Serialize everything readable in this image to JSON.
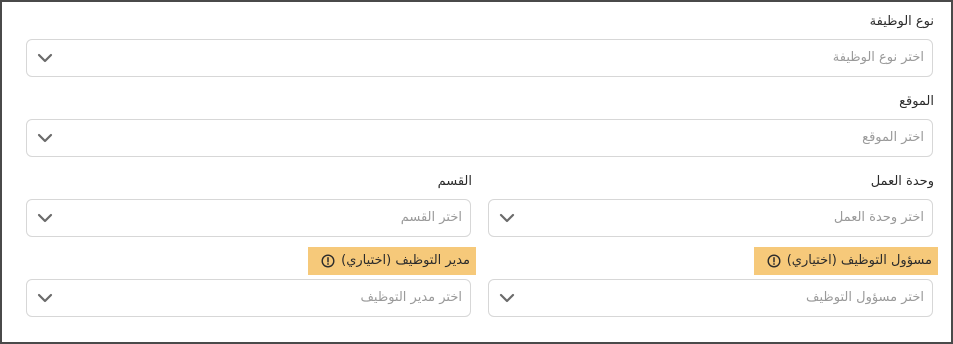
{
  "form": {
    "job_type": {
      "label": "نوع الوظيفة",
      "placeholder": "اختر نوع الوظيفة"
    },
    "location": {
      "label": "الموقع",
      "placeholder": "اختر الموقع"
    },
    "business_unit": {
      "label": "وحدة العمل",
      "placeholder": "اختر وحدة العمل"
    },
    "department": {
      "label": "القسم",
      "placeholder": "اختر القسم"
    },
    "hiring_officer": {
      "label": "مسؤول التوظيف (اختياري)",
      "placeholder": "اختر مسؤول التوظيف",
      "icon": "warning-circle-icon"
    },
    "hiring_manager": {
      "label": "مدير التوظيف (اختياري)",
      "placeholder": "اختر مدير التوظيف",
      "icon": "warning-circle-icon"
    }
  },
  "colors": {
    "highlight": "#f6c97a",
    "border": "#d7d7d7",
    "placeholder_text": "#9a9a9a",
    "chevron": "#6b6b6b"
  }
}
